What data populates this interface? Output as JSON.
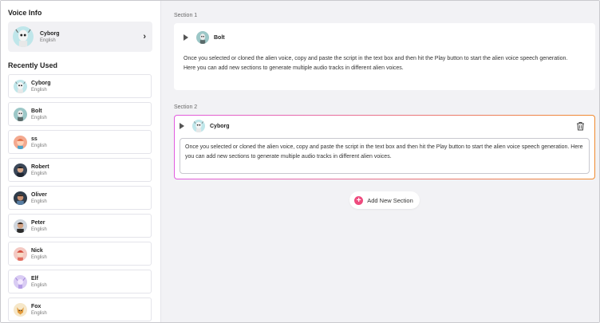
{
  "sidebar": {
    "voice_info_heading": "Voice Info",
    "selected_voice": {
      "name": "Cyborg",
      "language": "English",
      "icon": "cyborg-avatar"
    },
    "recently_used_heading": "Recently Used",
    "recent": [
      {
        "name": "Cyborg",
        "language": "English",
        "icon": "cyborg-avatar"
      },
      {
        "name": "Bolt",
        "language": "English",
        "icon": "bolt-avatar"
      },
      {
        "name": "ss",
        "language": "English",
        "icon": "ss-avatar"
      },
      {
        "name": "Robert",
        "language": "English",
        "icon": "robert-avatar"
      },
      {
        "name": "Oliver",
        "language": "English",
        "icon": "oliver-avatar"
      },
      {
        "name": "Peter",
        "language": "English",
        "icon": "peter-avatar"
      },
      {
        "name": "Nick",
        "language": "English",
        "icon": "nick-avatar"
      },
      {
        "name": "Elf",
        "language": "English",
        "icon": "elf-avatar"
      },
      {
        "name": "Fox",
        "language": "English",
        "icon": "fox-avatar"
      }
    ]
  },
  "main": {
    "sections": [
      {
        "label": "Section 1",
        "voice": "Bolt",
        "text": "Once you selected or cloned the alien voice, copy and paste the script in the text box and then hit the Play button to start the alien voice speech generation. Here you can add new sections to generate multiple audio tracks in different alien voices."
      },
      {
        "label": "Section 2",
        "voice": "Cyborg",
        "text": "Once you selected or cloned the alien voice, copy and paste the script in the text box and then hit the Play button to start the alien voice speech generation. Here you can add new sections to generate multiple audio tracks in different alien voices."
      }
    ],
    "add_section_label": "Add New Section"
  },
  "colors": {
    "accent_gradient_start": "#e25be0",
    "accent_gradient_end": "#f08a2e",
    "add_button_icon": "#ee4b7e",
    "main_background": "#f2f2f5"
  }
}
